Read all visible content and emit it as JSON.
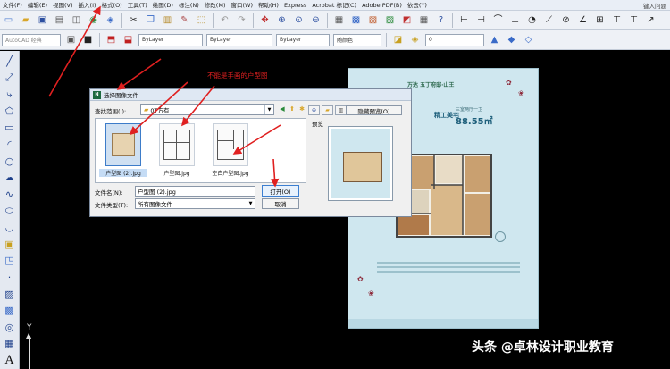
{
  "menubar": {
    "items": [
      "文件(F)",
      "编辑(E)",
      "视图(V)",
      "插入(I)",
      "格式(O)",
      "工具(T)",
      "绘图(D)",
      "标注(N)",
      "修改(M)",
      "窗口(W)",
      "帮助(H)",
      "Express",
      "Acrobat 标记(C)",
      "Adobe PDF(B)",
      "依云(Y)"
    ],
    "right_text": "键入问题"
  },
  "toolbar2": {
    "workspace": "AutoCAD 经典",
    "layer": "ByLayer",
    "linetype": "ByLayer",
    "lineweight": "ByLayer",
    "color": "随颜色",
    "style": "0"
  },
  "dialog": {
    "title": "选择图像文件",
    "title_icon": "N",
    "lookin_label": "查找范围(I):",
    "lookin_value": "0T方有",
    "hide_preview_label": "隐藏预览(O)",
    "preview_label": "预览",
    "files": [
      {
        "name": "户型图 (2).jpg",
        "selected": true
      },
      {
        "name": "户型图.jpg",
        "selected": false
      },
      {
        "name": "空白户型图.jpg",
        "selected": false
      }
    ],
    "filename_label": "文件名(N):",
    "filename_value": "户型图 (2).jpg",
    "filetype_label": "文件类型(T):",
    "filetype_value": "所有图像文件",
    "open_label": "打开(O)",
    "cancel_label": "取消"
  },
  "annotation": {
    "text": "不能是手画的户型图"
  },
  "poster": {
    "logo": "万达 五丁府邸·山王",
    "badge": "精工美宅",
    "subtitle": "三室两厅一卫",
    "area": "88.55㎡"
  },
  "canvas": {
    "ucs_y": "Y"
  },
  "watermark": {
    "text": "头条 @卓林设计职业教育"
  }
}
